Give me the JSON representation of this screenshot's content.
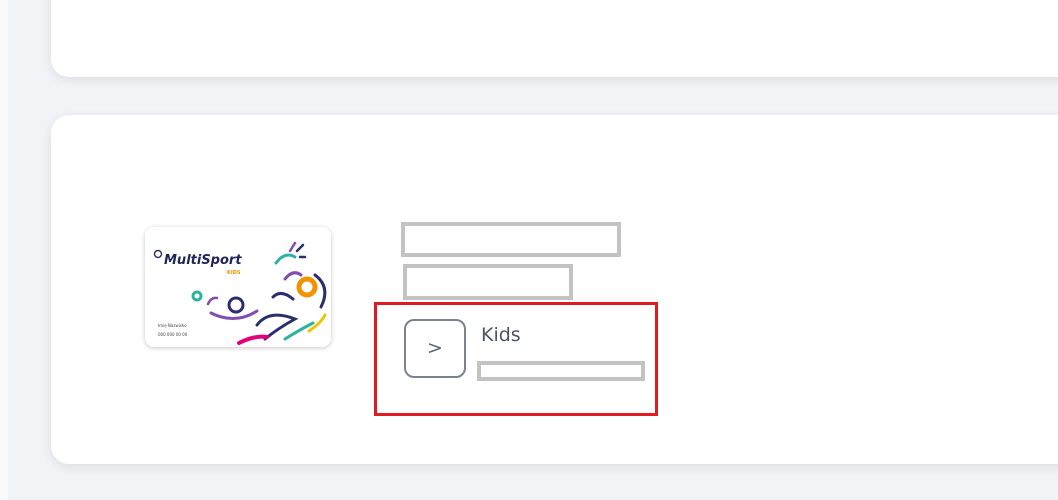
{
  "benefit_item": {
    "card_logo_text": "MultiSport",
    "card_logo_sub": "KIDS",
    "card_footer_line1": "Imię Nazwisko",
    "card_footer_line2": "000 000 00 00",
    "expand_icon": "chevron-right-icon",
    "expand_symbol": ">",
    "label": "Kids"
  },
  "colors": {
    "highlight": "#e11b22",
    "redaction": "#c3c3c3",
    "background": "#f2f3f6",
    "card": "#ffffff"
  }
}
